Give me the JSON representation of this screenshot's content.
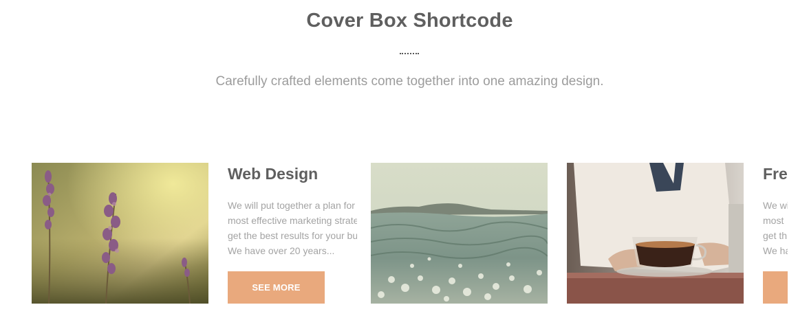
{
  "section": {
    "title": "Cover Box Shortcode",
    "subtitle": "Carefully crafted elements come together into one amazing design."
  },
  "slides": [
    {
      "image_subject": "lavender flowers",
      "heading": "Web Design",
      "description_lines": [
        "We will put together a plan for",
        "most effective marketing strategy",
        "get the best results for your bu",
        "We have over 20 years..."
      ],
      "button_label": "SEE MORE"
    },
    {
      "image_subject": "ocean wave",
      "heading": "",
      "description_lines": [],
      "button_label": ""
    },
    {
      "image_subject": "person with coffee cup",
      "heading": "Fre",
      "description_lines": [
        "We wi",
        "most",
        "get th",
        "We ha"
      ],
      "button_label": ""
    }
  ],
  "colors": {
    "accent": "#e9a97d",
    "title": "#5f5f5f",
    "subtitle": "#9c9c9c",
    "body_text": "#a3a3a3"
  }
}
